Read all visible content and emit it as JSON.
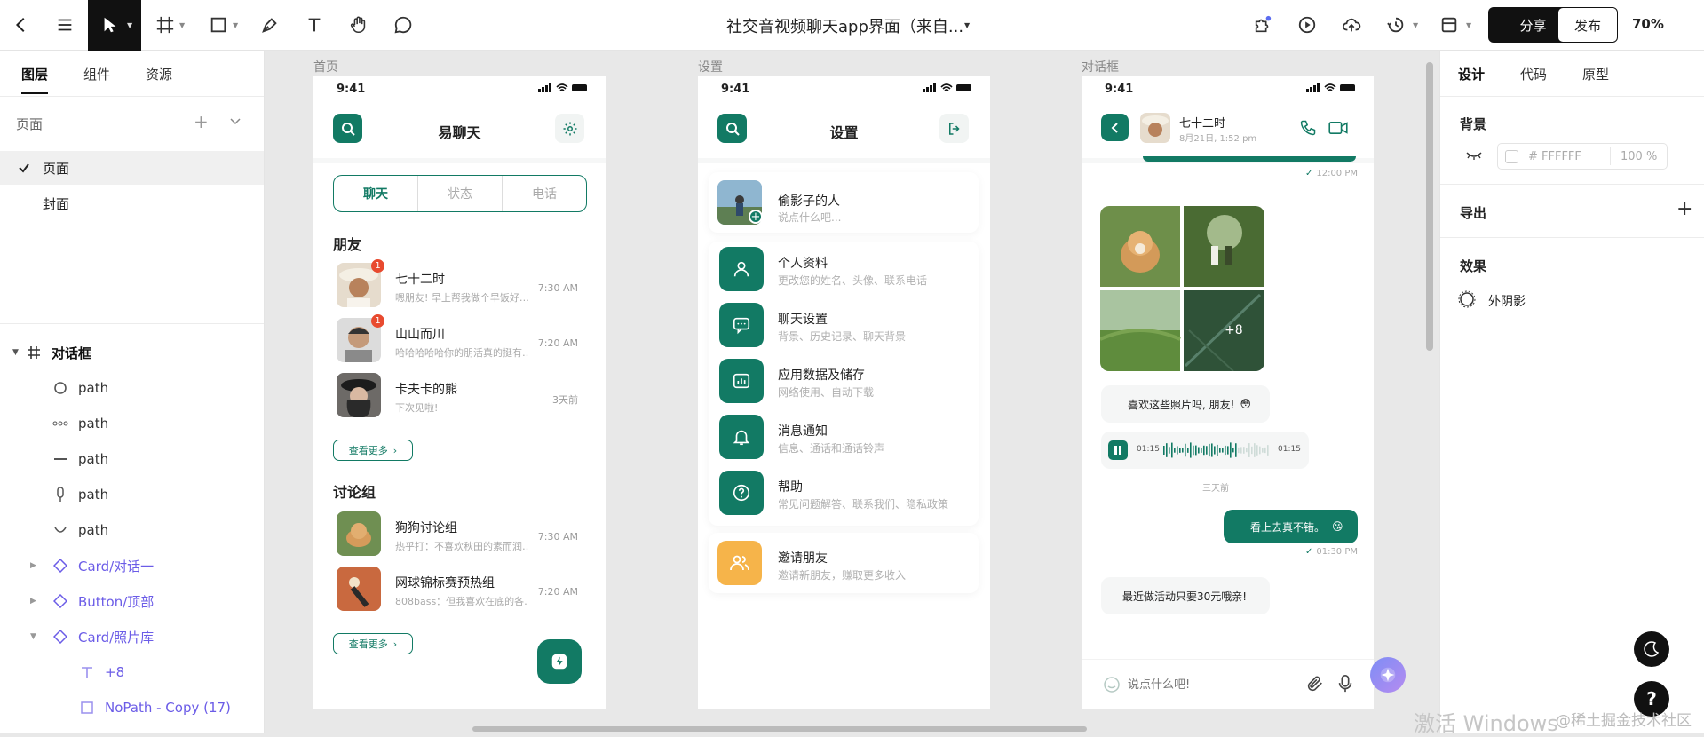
{
  "topbar": {
    "doc_title": "社交音视频聊天app界面（来自...",
    "share_label": "分享",
    "publish_label": "发布",
    "zoom": "70%",
    "icons": [
      "back-icon",
      "menu-icon",
      "cursor-icon",
      "frame-icon",
      "rectangle-icon",
      "pen-icon",
      "text-icon",
      "hand-icon",
      "comment-icon",
      "plugin-icon",
      "play-icon",
      "upload-icon",
      "history-icon",
      "layout-icon"
    ]
  },
  "left_panel": {
    "tabs": [
      "图层",
      "组件",
      "资源"
    ],
    "pages_label": "页面",
    "pages": [
      "页面",
      "封面"
    ],
    "frame_name": "对话框",
    "layers": [
      {
        "icon": "circle-icon",
        "label": "path"
      },
      {
        "icon": "dots-icon",
        "label": "path"
      },
      {
        "icon": "line-icon",
        "label": "path"
      },
      {
        "icon": "pin-icon",
        "label": "path"
      },
      {
        "icon": "arc-icon",
        "label": "path"
      },
      {
        "icon": "component-icon",
        "label": "Card/对话一"
      },
      {
        "icon": "component-icon",
        "label": "Button/顶部"
      },
      {
        "icon": "component-icon",
        "label": "Card/照片库"
      },
      {
        "icon": "text-layer-icon",
        "label": "+8"
      },
      {
        "icon": "rect-layer-icon",
        "label": "NoPath - Copy (17)"
      }
    ]
  },
  "frames": {
    "home": "首页",
    "settings": "设置",
    "dialog": "对话框"
  },
  "statusbar_time": "9:41",
  "home": {
    "title": "易聊天",
    "tabs": [
      "聊天",
      "状态",
      "电话"
    ],
    "friends_title": "朋友",
    "friends": [
      {
        "name": "七十二时",
        "msg": "嗯朋友! 早上帮我做个早饭好…",
        "time": "7:30 AM",
        "badge": "1"
      },
      {
        "name": "山山而川",
        "msg": "哈哈哈哈哈你的朋活真的挺有…",
        "time": "7:20 AM",
        "badge": "1"
      },
      {
        "name": "卡夫卡的熊",
        "msg": "下次见啦!",
        "time": "3天前",
        "badge": ""
      }
    ],
    "more_label": "查看更多",
    "groups_title": "讨论组",
    "groups": [
      {
        "name": "狗狗讨论组",
        "msg": "热乎打：不喜欢秋田的素而润…",
        "time": "7:30 AM"
      },
      {
        "name": "网球锦标赛预热组",
        "msg": "808bass：但我喜欢在底的各…",
        "time": "7:20 AM"
      }
    ]
  },
  "settings": {
    "title": "设置",
    "profile": {
      "name": "偷影子的人",
      "desc": "说点什么吧..."
    },
    "items": [
      {
        "icon": "user-icon",
        "name": "个人资料",
        "desc": "更改您的姓名、头像、联系电话"
      },
      {
        "icon": "chat-bubble-icon",
        "name": "聊天设置",
        "desc": "背景、历史记录、聊天背景"
      },
      {
        "icon": "data-icon",
        "name": "应用数据及储存",
        "desc": "网络使用、自动下载"
      },
      {
        "icon": "bell-icon",
        "name": "消息通知",
        "desc": "信息、通话和通话铃声"
      },
      {
        "icon": "help-icon",
        "name": "帮助",
        "desc": "常见问题解答、联系我们、隐私政策"
      }
    ],
    "invite": {
      "icon": "friends-icon",
      "name": "邀请朋友",
      "desc": "邀请新朋友，赚取更多收入"
    }
  },
  "dialog": {
    "contact_name": "七十二时",
    "contact_time": "8月21日, 1:52 pm",
    "time1": "12:00 PM",
    "photo_more": "+8",
    "msg1": "喜欢这些照片吗, 朋友!",
    "voice_start": "01:15",
    "voice_end": "01:15",
    "voice_date": "三天前",
    "msg2": "看上去真不错。",
    "time2": "01:30 PM",
    "msg3": "最近做活动只要30元哦亲!",
    "input_placeholder": "说点什么吧!"
  },
  "right_panel": {
    "tabs": [
      "设计",
      "代码",
      "原型"
    ],
    "bg_label": "背景",
    "bg_color": "# FFFFFF",
    "bg_opacity": "100 %",
    "export_label": "导出",
    "effects_label": "效果",
    "shadow_label": "外阴影"
  },
  "watermark": {
    "activate": "激活 Windows",
    "site": "@稀土掘金技术社区"
  },
  "colors": {
    "accent": "#127a64",
    "invite": "#f6b44a",
    "badge": "#e84a2f"
  }
}
